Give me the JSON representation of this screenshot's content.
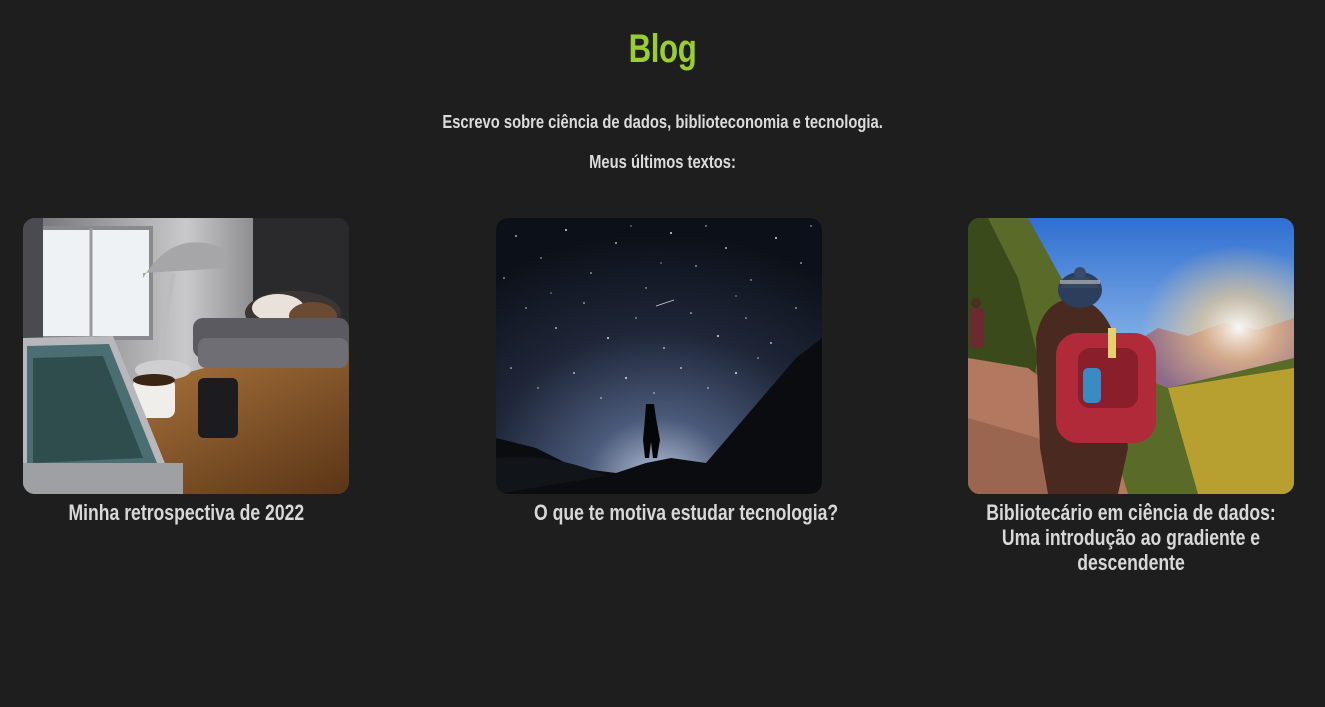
{
  "header": {
    "title": "Blog",
    "accent_color": "#9acd32"
  },
  "intro": {
    "line1": "Escrevo sobre ciência de dados, biblioteconomia e tecnologia.",
    "line2": "Meus últimos textos:"
  },
  "posts": [
    {
      "title": "Minha retrospectiva de 2022",
      "image_icon": "desk-laptop-cat-photo"
    },
    {
      "title": "O que te motiva estudar tecnologia?",
      "image_icon": "starry-night-silhouette-photo"
    },
    {
      "title": "Bibliotecário em ciência de dados: Uma introdução ao gradiente e descendente",
      "image_icon": "hikers-mountain-sunset-photo"
    }
  ],
  "colors": {
    "background": "#1e1e1e",
    "text": "#dcdcdc"
  }
}
